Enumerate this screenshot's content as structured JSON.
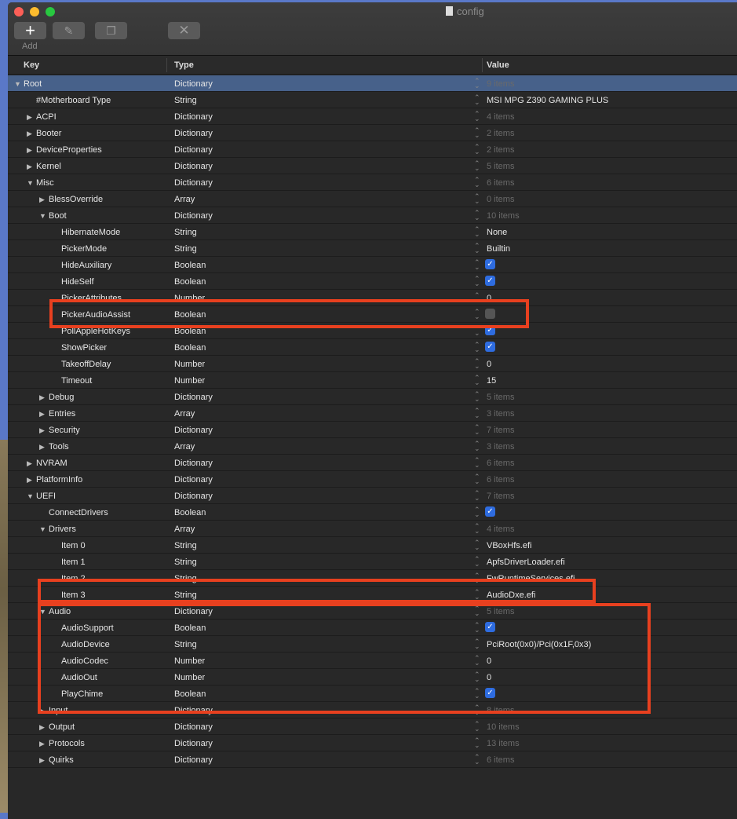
{
  "window": {
    "title": "config",
    "add_label": "Add"
  },
  "columns": {
    "key": "Key",
    "type": "Type",
    "value": "Value"
  },
  "rows": [
    {
      "key": "Root",
      "type": "Dictionary",
      "value": "9 items",
      "level": 0,
      "exp": "open",
      "sel": true
    },
    {
      "key": "#Motherboard Type",
      "type": "String",
      "value": "MSI MPG Z390 GAMING PLUS",
      "level": 1
    },
    {
      "key": "ACPI",
      "type": "Dictionary",
      "value": "4 items",
      "level": 1,
      "exp": "closed"
    },
    {
      "key": "Booter",
      "type": "Dictionary",
      "value": "2 items",
      "level": 1,
      "exp": "closed"
    },
    {
      "key": "DeviceProperties",
      "type": "Dictionary",
      "value": "2 items",
      "level": 1,
      "exp": "closed"
    },
    {
      "key": "Kernel",
      "type": "Dictionary",
      "value": "5 items",
      "level": 1,
      "exp": "closed"
    },
    {
      "key": "Misc",
      "type": "Dictionary",
      "value": "6 items",
      "level": 1,
      "exp": "open"
    },
    {
      "key": "BlessOverride",
      "type": "Array",
      "value": "0 items",
      "level": 2,
      "exp": "closed"
    },
    {
      "key": "Boot",
      "type": "Dictionary",
      "value": "10 items",
      "level": 2,
      "exp": "open"
    },
    {
      "key": "HibernateMode",
      "type": "String",
      "value": "None",
      "level": 3
    },
    {
      "key": "PickerMode",
      "type": "String",
      "value": "Builtin",
      "level": 3
    },
    {
      "key": "HideAuxiliary",
      "type": "Boolean",
      "value": true,
      "level": 3
    },
    {
      "key": "HideSelf",
      "type": "Boolean",
      "value": true,
      "level": 3
    },
    {
      "key": "PickerAttributes",
      "type": "Number",
      "value": "0",
      "level": 3
    },
    {
      "key": "PickerAudioAssist",
      "type": "Boolean",
      "value": false,
      "level": 3
    },
    {
      "key": "PollAppleHotKeys",
      "type": "Boolean",
      "value": true,
      "level": 3
    },
    {
      "key": "ShowPicker",
      "type": "Boolean",
      "value": true,
      "level": 3
    },
    {
      "key": "TakeoffDelay",
      "type": "Number",
      "value": "0",
      "level": 3
    },
    {
      "key": "Timeout",
      "type": "Number",
      "value": "15",
      "level": 3
    },
    {
      "key": "Debug",
      "type": "Dictionary",
      "value": "5 items",
      "level": 2,
      "exp": "closed"
    },
    {
      "key": "Entries",
      "type": "Array",
      "value": "3 items",
      "level": 2,
      "exp": "closed"
    },
    {
      "key": "Security",
      "type": "Dictionary",
      "value": "7 items",
      "level": 2,
      "exp": "closed"
    },
    {
      "key": "Tools",
      "type": "Array",
      "value": "3 items",
      "level": 2,
      "exp": "closed"
    },
    {
      "key": "NVRAM",
      "type": "Dictionary",
      "value": "6 items",
      "level": 1,
      "exp": "closed"
    },
    {
      "key": "PlatformInfo",
      "type": "Dictionary",
      "value": "6 items",
      "level": 1,
      "exp": "closed"
    },
    {
      "key": "UEFI",
      "type": "Dictionary",
      "value": "7 items",
      "level": 1,
      "exp": "open"
    },
    {
      "key": "ConnectDrivers",
      "type": "Boolean",
      "value": true,
      "level": 2
    },
    {
      "key": "Drivers",
      "type": "Array",
      "value": "4 items",
      "level": 2,
      "exp": "open"
    },
    {
      "key": "Item 0",
      "type": "String",
      "value": "VBoxHfs.efi",
      "level": 3
    },
    {
      "key": "Item 1",
      "type": "String",
      "value": "ApfsDriverLoader.efi",
      "level": 3
    },
    {
      "key": "Item 2",
      "type": "String",
      "value": "FwRuntimeServices.efi",
      "level": 3
    },
    {
      "key": "Item 3",
      "type": "String",
      "value": "AudioDxe.efi",
      "level": 3
    },
    {
      "key": "Audio",
      "type": "Dictionary",
      "value": "5 items",
      "level": 2,
      "exp": "open"
    },
    {
      "key": "AudioSupport",
      "type": "Boolean",
      "value": true,
      "level": 3
    },
    {
      "key": "AudioDevice",
      "type": "String",
      "value": "PciRoot(0x0)/Pci(0x1F,0x3)",
      "level": 3
    },
    {
      "key": "AudioCodec",
      "type": "Number",
      "value": "0",
      "level": 3
    },
    {
      "key": "AudioOut",
      "type": "Number",
      "value": "0",
      "level": 3
    },
    {
      "key": "PlayChime",
      "type": "Boolean",
      "value": true,
      "level": 3
    },
    {
      "key": "Input",
      "type": "Dictionary",
      "value": "8 items",
      "level": 2,
      "exp": "closed"
    },
    {
      "key": "Output",
      "type": "Dictionary",
      "value": "10 items",
      "level": 2,
      "exp": "closed"
    },
    {
      "key": "Protocols",
      "type": "Dictionary",
      "value": "13 items",
      "level": 2,
      "exp": "closed"
    },
    {
      "key": "Quirks",
      "type": "Dictionary",
      "value": "6 items",
      "level": 2,
      "exp": "closed"
    }
  ]
}
